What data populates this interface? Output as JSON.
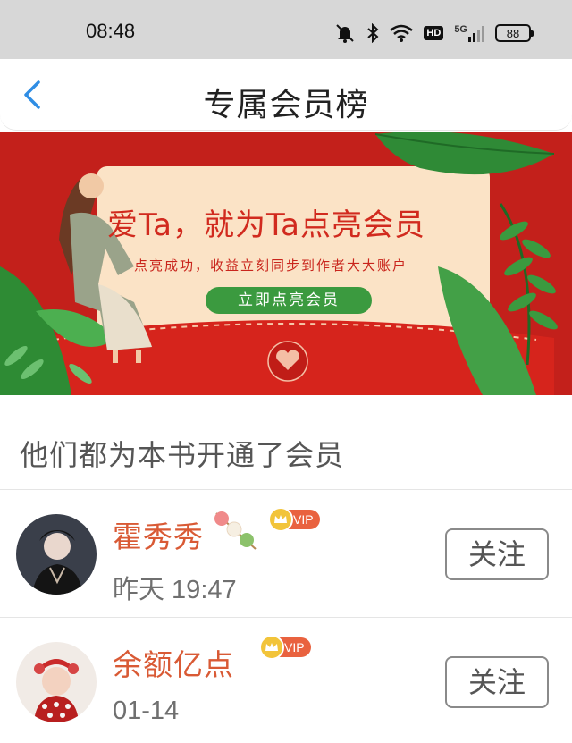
{
  "status_bar": {
    "time": "08:48",
    "battery": "88",
    "network_label": "HD",
    "signal_label": "5G"
  },
  "header": {
    "title": "专属会员榜"
  },
  "banner": {
    "headline": "爱Ta，就为Ta点亮会员",
    "subtitle": "点亮成功，收益立刻同步到作者大大账户",
    "cta": "立即点亮会员"
  },
  "section": {
    "title": "他们都为本书开通了会员"
  },
  "members": [
    {
      "name": "霍秀秀",
      "time": "昨天 19:47",
      "badge": "VIP",
      "follow_label": "关注"
    },
    {
      "name": "余额亿点",
      "time": "01-14",
      "badge": "VIP",
      "follow_label": "关注"
    }
  ],
  "colors": {
    "accent_red": "#c3201b",
    "name_orange": "#d95a35",
    "cta_green": "#3b9a3f",
    "back_blue": "#2f8de4"
  }
}
